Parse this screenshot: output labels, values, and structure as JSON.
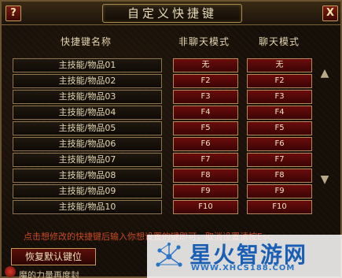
{
  "window": {
    "title": "自定义快捷键",
    "help_label": "?",
    "close_label": "X"
  },
  "columns": {
    "name": "快捷键名称",
    "non_chat": "非聊天模式",
    "chat": "聊天模式"
  },
  "rows": [
    {
      "name": "主技能/物品01",
      "non_chat": "无",
      "chat": "无"
    },
    {
      "name": "主技能/物品02",
      "non_chat": "F2",
      "chat": "F2"
    },
    {
      "name": "主技能/物品03",
      "non_chat": "F3",
      "chat": "F3"
    },
    {
      "name": "主技能/物品04",
      "non_chat": "F4",
      "chat": "F4"
    },
    {
      "name": "主技能/物品05",
      "non_chat": "F5",
      "chat": "F5"
    },
    {
      "name": "主技能/物品06",
      "non_chat": "F6",
      "chat": "F6"
    },
    {
      "name": "主技能/物品07",
      "non_chat": "F7",
      "chat": "F7"
    },
    {
      "name": "主技能/物品08",
      "non_chat": "F8",
      "chat": "F8"
    },
    {
      "name": "主技能/物品09",
      "non_chat": "F9",
      "chat": "F9"
    },
    {
      "name": "主技能/物品10",
      "non_chat": "F10",
      "chat": "F10"
    }
  ],
  "scroll": {
    "up_icon": "chevron-up-icon",
    "down_icon": "chevron-down-icon"
  },
  "hint": "点击想修改的快捷键后输入你想设置的键即可，取消设置请按Esc",
  "restore_label": "恢复默认键位",
  "bottom_text": "魔的力量再度封",
  "watermark": {
    "name": "星火智游网",
    "url": "WWW.XHCS188.COM"
  },
  "colors": {
    "key_cell": "#6a0c0c",
    "hint": "#c84a2a",
    "watermark_blue": "#1a5fb4"
  }
}
